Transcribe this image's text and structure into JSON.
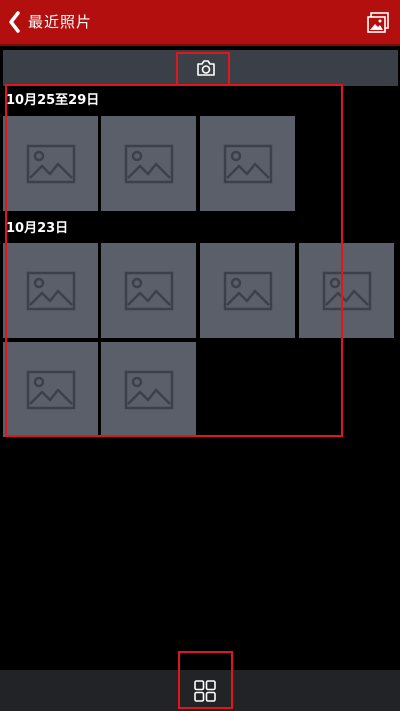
{
  "header": {
    "title": "最近照片",
    "back_icon": "chevron-left-icon",
    "gallery_icon": "gallery-icon"
  },
  "camera_bar": {
    "icon": "camera-icon"
  },
  "sections": [
    {
      "date": "10月25至29日",
      "photo_count": 3
    },
    {
      "date": "10月23日",
      "photo_count": 6
    }
  ],
  "bottom_bar": {
    "icon": "grid-view-icon"
  },
  "colors": {
    "header_bg": "#b30f0f",
    "camera_bar_bg": "#3b3f47",
    "thumb_bg": "#5b5f6a",
    "highlight": "#e0161b",
    "bottom_bar_bg": "#222326"
  }
}
